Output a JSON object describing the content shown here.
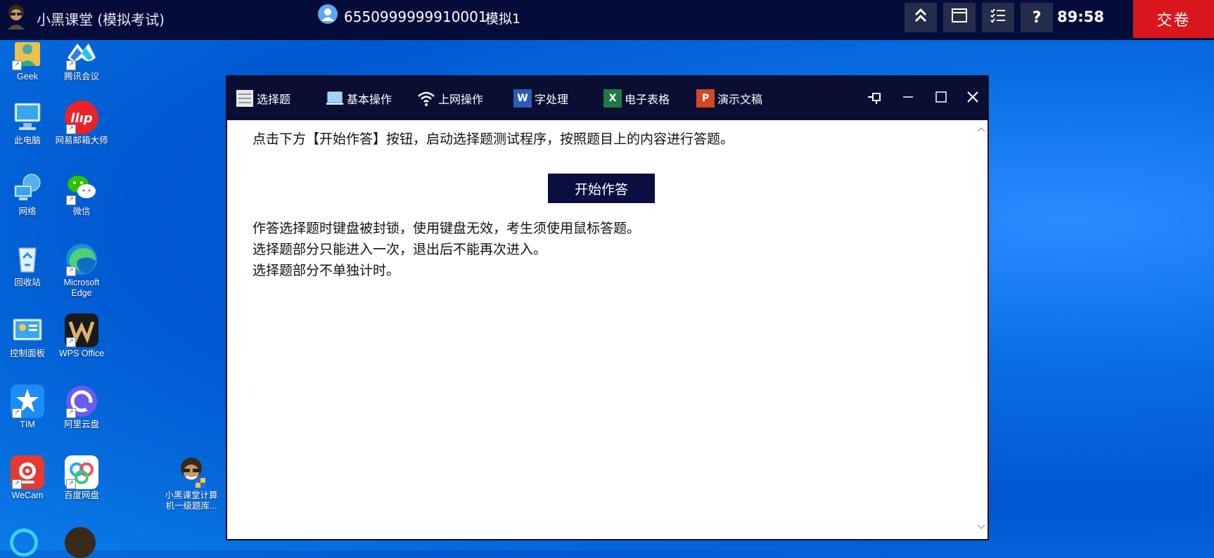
{
  "topbar": {
    "app_title": "小黑课堂 (模拟考试)",
    "exam_id": "6550999999910001",
    "exam_mode": "模拟1",
    "timer": "89:58",
    "submit_label": "交卷",
    "tools": [
      {
        "icon": "collapse-up-icon",
        "glyph": "⌃"
      },
      {
        "icon": "window-icon",
        "glyph": "▭"
      },
      {
        "icon": "checklist-icon",
        "glyph": "☰"
      },
      {
        "icon": "help-icon",
        "glyph": "?"
      }
    ],
    "colors": {
      "bar": "#060c3a",
      "submit": "#d9161c"
    }
  },
  "desktop": {
    "icons": [
      {
        "label": "Geek",
        "name": "geek"
      },
      {
        "label": "腾讯会议",
        "name": "tencent-meeting"
      },
      {
        "label": "此电脑",
        "name": "this-pc"
      },
      {
        "label": "网易邮箱大师",
        "name": "netease-mail"
      },
      {
        "label": "网络",
        "name": "network"
      },
      {
        "label": "微信",
        "name": "wechat"
      },
      {
        "label": "回收站",
        "name": "recycle-bin"
      },
      {
        "label": "Microsoft Edge",
        "name": "edge"
      },
      {
        "label": "控制面板",
        "name": "control-panel"
      },
      {
        "label": "WPS Office",
        "name": "wps-office"
      },
      {
        "label": "TIM",
        "name": "tim"
      },
      {
        "label": "阿里云盘",
        "name": "aliyun-drive"
      },
      {
        "label": "WeCam",
        "name": "wecam"
      },
      {
        "label": "百度网盘",
        "name": "baidu-netdisk"
      },
      {
        "label": "小黑课堂计算机一级题库...",
        "name": "xiaohei-question-bank"
      }
    ]
  },
  "window": {
    "tabs": [
      {
        "label": "选择题",
        "icon": "list-icon"
      },
      {
        "label": "基本操作",
        "icon": "monitor-icon"
      },
      {
        "label": "上网操作",
        "icon": "wifi-icon"
      },
      {
        "label": "字处理",
        "icon": "word-icon",
        "glyph": "W"
      },
      {
        "label": "电子表格",
        "icon": "excel-icon",
        "glyph": "X"
      },
      {
        "label": "演示文稿",
        "icon": "powerpoint-icon",
        "glyph": "P"
      }
    ],
    "intro_text": "点击下方【开始作答】按钮，启动选择题测试程序，按照题目上的内容进行答题。",
    "start_button": "开始作答",
    "notes": [
      "作答选择题时键盘被封锁，使用键盘无效，考生须使用鼠标答题。",
      "选择题部分只能进入一次，退出后不能再次进入。",
      "选择题部分不单独计时。"
    ]
  }
}
